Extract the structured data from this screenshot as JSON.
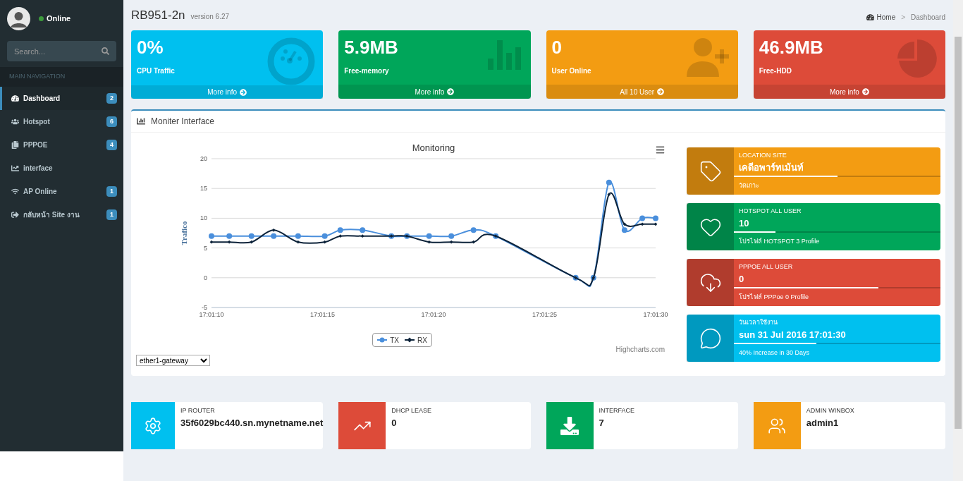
{
  "user": {
    "status": "Online",
    "online": true
  },
  "search": {
    "placeholder": "Search..."
  },
  "nav_header": "MAIN NAVIGATION",
  "nav": [
    {
      "kind": "dashboard",
      "label": "Dashboard",
      "badge": "2",
      "selected": true
    },
    {
      "kind": "users",
      "label": "Hotspot",
      "badge": "6",
      "selected": false
    },
    {
      "kind": "copy",
      "label": "PPPOE",
      "badge": "4",
      "selected": false
    },
    {
      "kind": "chart",
      "label": "interface",
      "selected": false
    },
    {
      "kind": "wifi",
      "label": "AP Online",
      "badge": "1",
      "selected": false
    },
    {
      "kind": "exit",
      "label": "กลับหน้า Site งาน",
      "badge": "1",
      "selected": false
    }
  ],
  "header": {
    "title": "RB951-2n",
    "subtitle": "version 6.27"
  },
  "breadcrumb": [
    "Home",
    "Dashboard"
  ],
  "breadcrumb_separator": ">",
  "stats": [
    {
      "kind": "gauge",
      "color": "#00c0ef",
      "value": "0%",
      "label": "CPU Traffic",
      "footer": "More info"
    },
    {
      "kind": "bars",
      "color": "#00a65a",
      "value": "5.9MB",
      "label": "Free-memory",
      "footer": "More info"
    },
    {
      "kind": "user-plus",
      "color": "#f39c12",
      "value": "0",
      "label": "User Online",
      "footer": "All 10 User"
    },
    {
      "kind": "pie",
      "color": "#dd4b39",
      "value": "46.9MB",
      "label": "Free-HDD",
      "footer": "More info"
    }
  ],
  "panel": {
    "title": "Moniter Interface",
    "credit": "Highcharts.com",
    "interface_select": {
      "value": "ether1-gateway"
    },
    "chart_data": {
      "type": "line",
      "title": "Monitoring",
      "ylabel": "Trafico",
      "grid": true,
      "x": [
        61270,
        61270.8,
        61271.8,
        61272.8,
        61273.9,
        61275.1,
        61275.8,
        61276.8,
        61278.1,
        61278.8,
        61279.8,
        61280.8,
        61281.8,
        61282.8,
        61286.4,
        61287.2,
        61287.9,
        61288.6,
        61289.4,
        61290
      ],
      "xlim": [
        61270,
        61290
      ],
      "ylim": [
        -5,
        20
      ],
      "xticks": [
        {
          "value": 61270,
          "label": "17:01:10"
        },
        {
          "value": 61275,
          "label": "17:01:15"
        },
        {
          "value": 61280,
          "label": "17:01:20"
        },
        {
          "value": 61285,
          "label": "17:01:25"
        },
        {
          "value": 61290,
          "label": "17:01:30"
        }
      ],
      "yticks": [
        -5,
        0,
        5,
        10,
        15,
        20
      ],
      "series": [
        {
          "name": "TX",
          "color": "#4a8fdc",
          "marker": "circle",
          "values": [
            7,
            7,
            7,
            7,
            7,
            7,
            8,
            8,
            7,
            7,
            7,
            7,
            8,
            7,
            0,
            0,
            16,
            8,
            10,
            10
          ]
        },
        {
          "name": "RX",
          "color": "#0d233a",
          "marker": "diamond",
          "values": [
            6,
            6,
            6,
            8,
            6,
            6,
            7,
            7,
            7,
            7,
            6,
            6,
            6,
            7,
            0,
            0,
            14,
            9,
            9,
            9
          ]
        }
      ]
    }
  },
  "info_boxes": [
    {
      "kind": "tag",
      "color": "#f39c12",
      "label": "LOCATION SITE",
      "value": "เคดีอพาร์ทเม้นท์",
      "level": 0.5,
      "description": "วัดเกาะ"
    },
    {
      "kind": "heart",
      "color": "#00a65a",
      "label": "HOTSPOT ALL USER",
      "value": "10",
      "level": 0.2,
      "description": "โปรไฟล์ HOTSPOT 3 Profile"
    },
    {
      "kind": "cloud",
      "color": "#dd4b39",
      "label": "PPPOE ALL USER",
      "value": "0",
      "level": 0.7,
      "description": "โปรไฟล์ PPPoe 0 Profile"
    },
    {
      "kind": "comment",
      "color": "#00c0ef",
      "label": "วันเวลาใช้งาน",
      "value": "sun 31 Jul 2016 17:01:30",
      "level": 0.4,
      "description": "40% Increase in 30 Days"
    }
  ],
  "bottom_boxes": [
    {
      "kind": "gear",
      "color": "#00c0ef",
      "label": "IP ROUTER",
      "value": "35f6029bc440.sn.mynetname.net"
    },
    {
      "kind": "trend",
      "color": "#dd4b39",
      "label": "DHCP LEASE",
      "value": "0"
    },
    {
      "kind": "download",
      "color": "#00a65a",
      "label": "INTERFACE",
      "value": "7"
    },
    {
      "kind": "users",
      "color": "#f39c12",
      "label": "ADMIN WINBOX",
      "value": "admin1"
    }
  ]
}
